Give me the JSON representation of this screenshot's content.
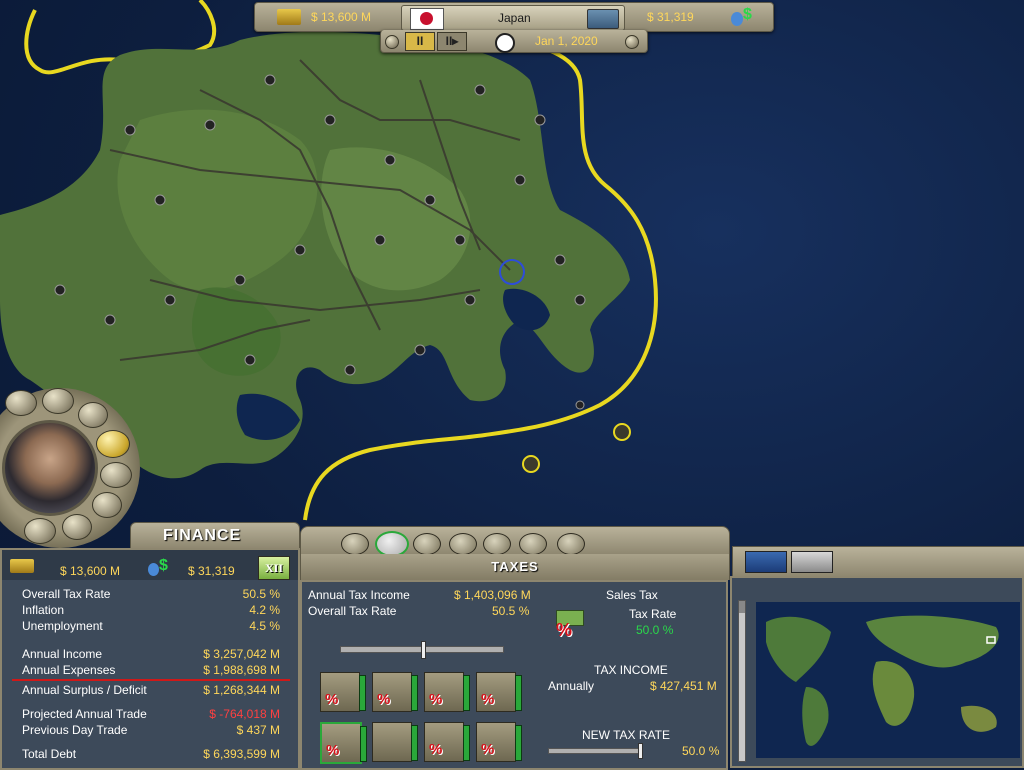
{
  "top_bar": {
    "treasury": "$ 13,600 M",
    "country": "Japan",
    "gdp_per_capita": "$ 31,319",
    "date": "Jan 1, 2020",
    "pause_label": "II",
    "play_label": "II▸"
  },
  "advisor": {
    "title": "FINANCE"
  },
  "finance": {
    "treasury": "$ 13,600 M",
    "gdp_per_capita": "$ 31,319",
    "badge": "XII",
    "rows": [
      {
        "label": "Overall Tax Rate",
        "value": "50.5 %"
      },
      {
        "label": "Inflation",
        "value": "4.2 %"
      },
      {
        "label": "Unemployment",
        "value": "4.5 %"
      },
      {
        "label": "Annual Income",
        "value": "$ 3,257,042 M"
      },
      {
        "label": "Annual Expenses",
        "value": "$ 1,988,698 M"
      },
      {
        "label": "Annual Surplus / Deficit",
        "value": "$ 1,268,344 M"
      },
      {
        "label": "Projected Annual Trade",
        "value": "$ -764,018 M"
      },
      {
        "label": "Previous Day Trade",
        "value": "$ 437 M"
      },
      {
        "label": "Total Debt",
        "value": "$ 6,393,599 M"
      }
    ]
  },
  "taxes": {
    "title": "TAXES",
    "annual_tax_income_label": "Annual Tax Income",
    "annual_tax_income_value": "$ 1,403,096 M",
    "overall_tax_rate_label": "Overall Tax Rate",
    "overall_tax_rate_value": "50.5 %",
    "overall_tax_rate_slider": 0.5,
    "sales_tax_label": "Sales Tax",
    "tax_rate_label": "Tax Rate",
    "tax_rate_value": "50.0 %",
    "tax_income_label": "TAX INCOME",
    "annually_label": "Annually",
    "annually_value": "$ 427,451 M",
    "new_tax_rate_label": "NEW TAX RATE",
    "new_tax_rate_value": "50.0 %",
    "new_tax_rate_slider": 0.5,
    "tiles": [
      {
        "name": "income-tax-tile",
        "icon": "money-percent-icon"
      },
      {
        "name": "resource-tax-tile",
        "icon": "pump-percent-icon"
      },
      {
        "name": "property-tax-tile",
        "icon": "bank-percent-icon"
      },
      {
        "name": "payroll-tax-tile",
        "icon": "workers-percent-icon"
      },
      {
        "name": "sales-tax-tile",
        "icon": "bills-percent-icon"
      },
      {
        "name": "import-tax-tile",
        "icon": "worker-hardhat-icon"
      },
      {
        "name": "vehicle-tax-tile",
        "icon": "fuel-percent-icon"
      },
      {
        "name": "family-tax-tile",
        "icon": "family-percent-icon"
      }
    ]
  },
  "colors": {
    "value_text": "#ffd75a",
    "negative_text": "#ff4040",
    "panel_bg": "#3d4a5a",
    "panel_border": "#8d866f",
    "ocean": "#0d1e3e",
    "border_line": "#e8d820"
  }
}
